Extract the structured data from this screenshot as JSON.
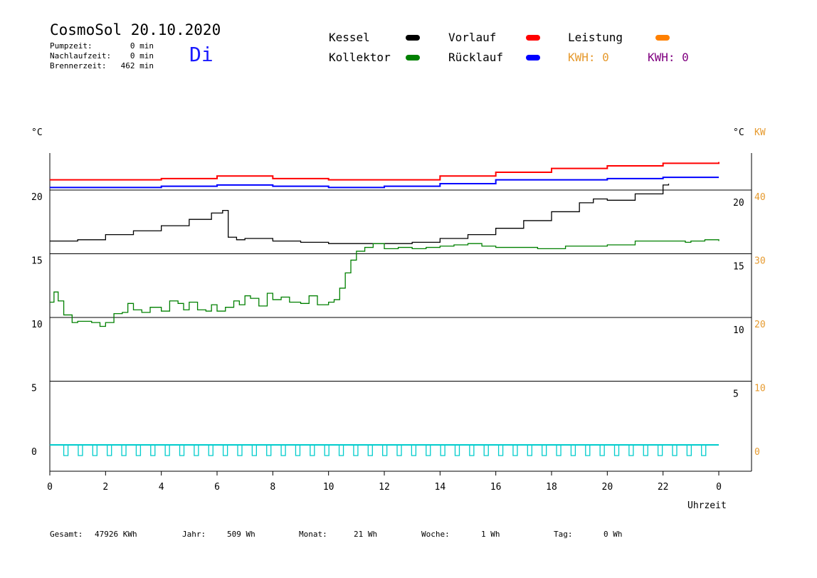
{
  "header": {
    "title": "CosmoSol 20.10.2020",
    "weekday": "Di",
    "stats": [
      {
        "label": "Pumpzeit:",
        "value": "0 min"
      },
      {
        "label": "Nachlaufzeit:",
        "value": "0 min"
      },
      {
        "label": "Brennerzeit:",
        "value": "462 min"
      }
    ]
  },
  "legend": {
    "kessel": {
      "label": "Kessel",
      "color": "#000000"
    },
    "kollektor": {
      "label": "Kollektor",
      "color": "#008000"
    },
    "vorlauf": {
      "label": "Vorlauf",
      "color": "#ff0000"
    },
    "ruecklauf": {
      "label": "Rücklauf",
      "color": "#0000ff"
    },
    "leistung": {
      "label": "Leistung",
      "color": "#ff8000"
    },
    "kwh1": {
      "label": "KWH: 0",
      "color": "#e69a2e"
    },
    "kwh2": {
      "label": "KWH: 0",
      "color": "#800080"
    }
  },
  "axes": {
    "left_unit": "°C",
    "right_unit1": "°C",
    "right_unit2": "KW",
    "xlabel": "Uhrzeit"
  },
  "chart_data": {
    "type": "line",
    "xlim": [
      0,
      24
    ],
    "x_ticks": [
      "0",
      "2",
      "4",
      "6",
      "8",
      "10",
      "12",
      "14",
      "16",
      "18",
      "20",
      "22",
      "0"
    ],
    "y_left_ticks": [
      "0",
      "5",
      "10",
      "15",
      "20"
    ],
    "y_right_ticks": [
      "5",
      "10",
      "15",
      "20"
    ],
    "y_kw_ticks": [
      "0",
      "10",
      "20",
      "30",
      "40"
    ],
    "ylim": [
      -2,
      23
    ],
    "series": [
      {
        "name": "Vorlauf",
        "color": "#ff0000",
        "x": [
          0,
          2,
          4,
          6,
          8,
          10,
          12,
          14,
          16,
          18,
          20,
          22,
          24
        ],
        "values": [
          20.8,
          20.8,
          20.9,
          21.1,
          20.9,
          20.8,
          20.8,
          21.1,
          21.4,
          21.7,
          21.9,
          22.1,
          22.2
        ]
      },
      {
        "name": "Rücklauf",
        "color": "#0000ff",
        "x": [
          0,
          2,
          4,
          6,
          8,
          10,
          12,
          14,
          16,
          18,
          20,
          22,
          24
        ],
        "values": [
          20.2,
          20.2,
          20.3,
          20.4,
          20.3,
          20.2,
          20.3,
          20.5,
          20.8,
          20.8,
          20.9,
          21.0,
          21.0
        ]
      },
      {
        "name": "Kessel",
        "color": "#000000",
        "x": [
          0,
          1,
          2,
          3,
          4,
          5,
          5.8,
          6.2,
          6.4,
          6.7,
          7,
          8,
          9,
          10,
          11,
          12,
          13,
          14,
          15,
          16,
          17,
          18,
          19,
          19.5,
          20,
          21,
          22,
          22.2
        ],
        "values": [
          16.0,
          16.1,
          16.5,
          16.8,
          17.2,
          17.7,
          18.2,
          18.4,
          16.3,
          16.1,
          16.2,
          16.0,
          15.9,
          15.8,
          15.8,
          15.8,
          15.9,
          16.2,
          16.5,
          17.0,
          17.6,
          18.3,
          19.0,
          19.3,
          19.2,
          19.7,
          20.4,
          20.5
        ]
      },
      {
        "name": "Kollektor",
        "color": "#008000",
        "x": [
          0,
          0.15,
          0.3,
          0.5,
          0.8,
          1,
          1.5,
          1.8,
          2,
          2.3,
          2.6,
          2.8,
          3,
          3.3,
          3.6,
          4,
          4.3,
          4.6,
          4.8,
          5,
          5.3,
          5.6,
          5.8,
          6,
          6.3,
          6.6,
          6.8,
          7,
          7.2,
          7.5,
          7.8,
          8,
          8.3,
          8.6,
          9,
          9.3,
          9.6,
          9.8,
          10,
          10.2,
          10.4,
          10.6,
          10.8,
          11,
          11.3,
          11.6,
          12,
          12.5,
          13,
          13.5,
          14,
          14.5,
          15,
          15.5,
          16,
          17,
          17.5,
          18,
          18.5,
          19,
          20,
          21,
          22,
          22.5,
          22.8,
          23,
          23.5,
          24
        ],
        "values": [
          11.2,
          12.0,
          11.3,
          10.2,
          9.6,
          9.7,
          9.6,
          9.3,
          9.6,
          10.3,
          10.4,
          11.1,
          10.6,
          10.4,
          10.8,
          10.5,
          11.3,
          11.1,
          10.6,
          11.2,
          10.6,
          10.5,
          11.0,
          10.5,
          10.8,
          11.3,
          11.0,
          11.7,
          11.5,
          10.9,
          11.9,
          11.4,
          11.6,
          11.2,
          11.1,
          11.7,
          11.0,
          11.0,
          11.2,
          11.4,
          12.3,
          13.5,
          14.5,
          15.2,
          15.5,
          15.8,
          15.4,
          15.5,
          15.4,
          15.5,
          15.6,
          15.7,
          15.8,
          15.6,
          15.5,
          15.5,
          15.4,
          15.4,
          15.6,
          15.6,
          15.7,
          16.0,
          16.0,
          16.0,
          15.9,
          16.0,
          16.1,
          16.0
        ]
      }
    ]
  },
  "footer": [
    {
      "label": "Gesamt:",
      "value": "47926 KWh"
    },
    {
      "label": "Jahr:",
      "value": "509 Wh"
    },
    {
      "label": "Monat:",
      "value": "21 Wh"
    },
    {
      "label": "Woche:",
      "value": "1 Wh"
    },
    {
      "label": "Tag:",
      "value": "0 Wh"
    }
  ]
}
